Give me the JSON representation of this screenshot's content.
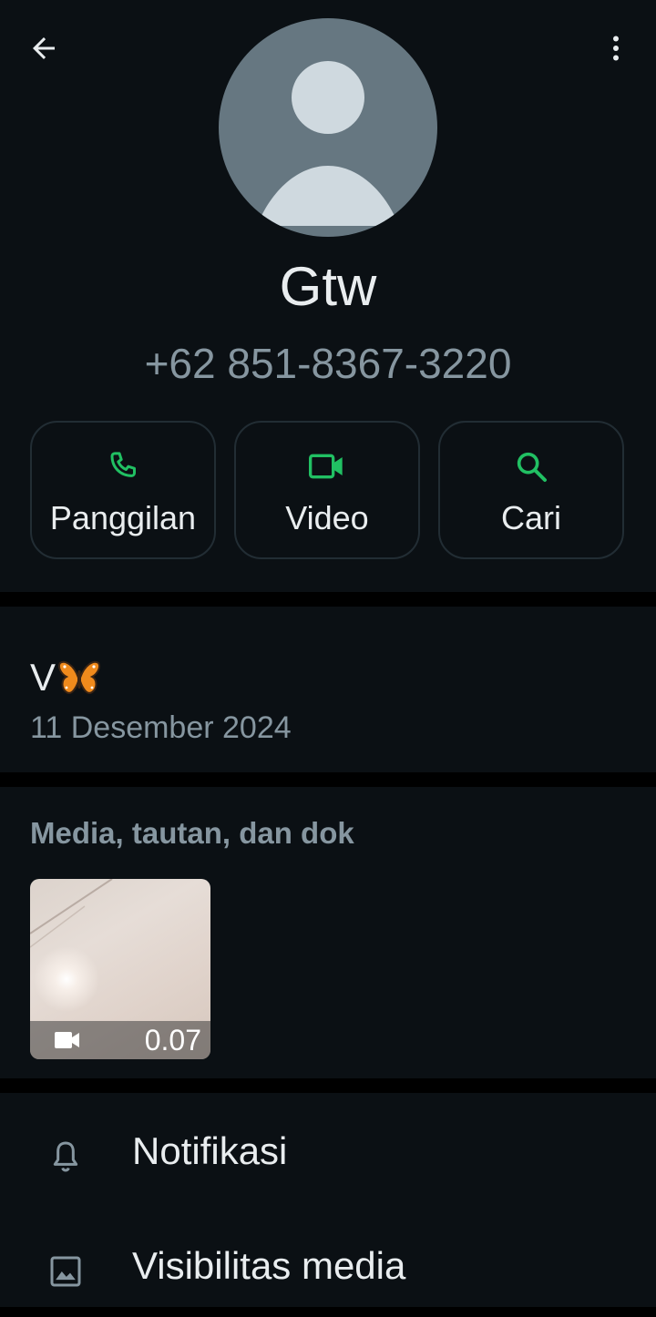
{
  "header": {
    "back_icon": "arrow-left-icon",
    "more_icon": "more-vert-icon"
  },
  "profile": {
    "avatar_icon": "default-person-avatar",
    "name": "Gtw",
    "phone": "+62 851-8367-3220"
  },
  "actions": [
    {
      "label": "Panggilan",
      "icon": "phone-icon"
    },
    {
      "label": "Video",
      "icon": "video-camera-icon"
    },
    {
      "label": "Cari",
      "icon": "search-icon"
    }
  ],
  "about": {
    "text": "V",
    "emoji": "butterfly-emoji",
    "date": "11 Desember 2024"
  },
  "media": {
    "header": "Media, tautan, dan dok",
    "items": [
      {
        "type": "video",
        "duration": "0.07",
        "icon": "video-camera-icon"
      }
    ]
  },
  "settings": [
    {
      "label": "Notifikasi",
      "icon": "bell-icon"
    },
    {
      "label": "Visibilitas media",
      "icon": "image-icon"
    }
  ],
  "colors": {
    "background": "#0b1014",
    "accent_green": "#21c063",
    "primary_text": "#e9edef",
    "secondary_text": "#8696a0"
  }
}
